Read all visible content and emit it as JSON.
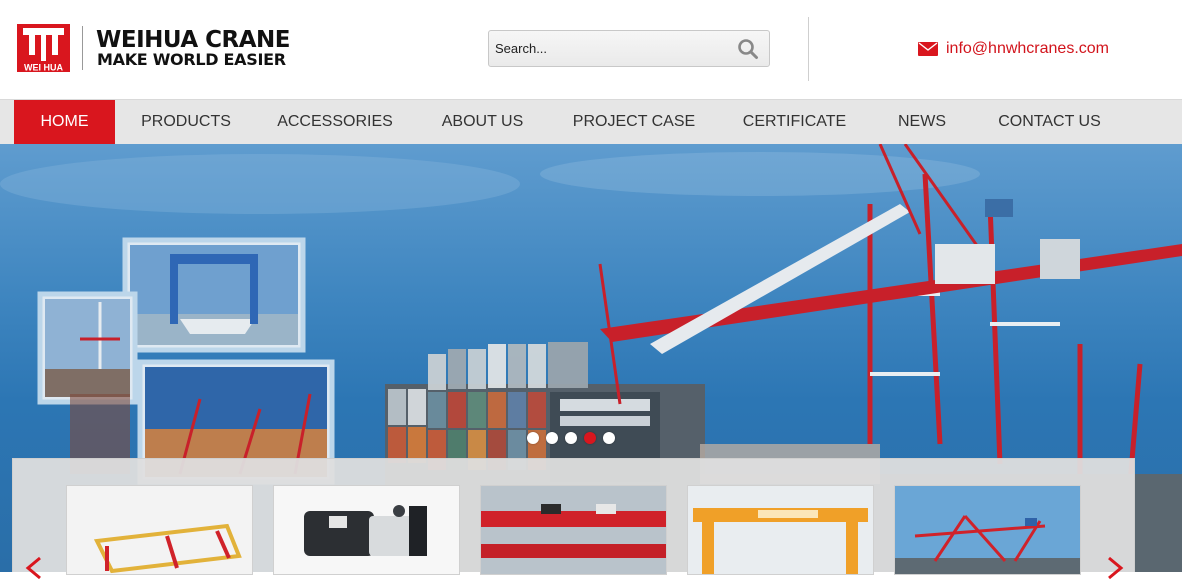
{
  "brand": {
    "logo_text": "WEI HUA",
    "title": "WEIHUA CRANE",
    "slogan": "MAKE WORLD EASIER",
    "red": "#d9161e"
  },
  "search": {
    "placeholder": "Search...",
    "icon": "magnifier-icon"
  },
  "contact": {
    "icon": "envelope-icon",
    "email": "info@hnwhcranes.com"
  },
  "nav": {
    "items": [
      {
        "label": "HOME",
        "active": true
      },
      {
        "label": "PRODUCTS"
      },
      {
        "label": "ACCESSORIES"
      },
      {
        "label": "ABOUT US"
      },
      {
        "label": "PROJECT CASE"
      },
      {
        "label": "CERTIFICATE"
      },
      {
        "label": "NEWS"
      },
      {
        "label": "CONTACT US"
      }
    ]
  },
  "slider": {
    "slide_count": 5,
    "active_slide": 4
  },
  "products": {
    "thumbnails": [
      "crane-frame-photo",
      "electric-hoist-photo",
      "overhead-crane-photo",
      "gantry-crane-photo",
      "port-crane-photo"
    ],
    "prev_icon": "chevron-left-icon",
    "next_icon": "chevron-right-icon"
  }
}
